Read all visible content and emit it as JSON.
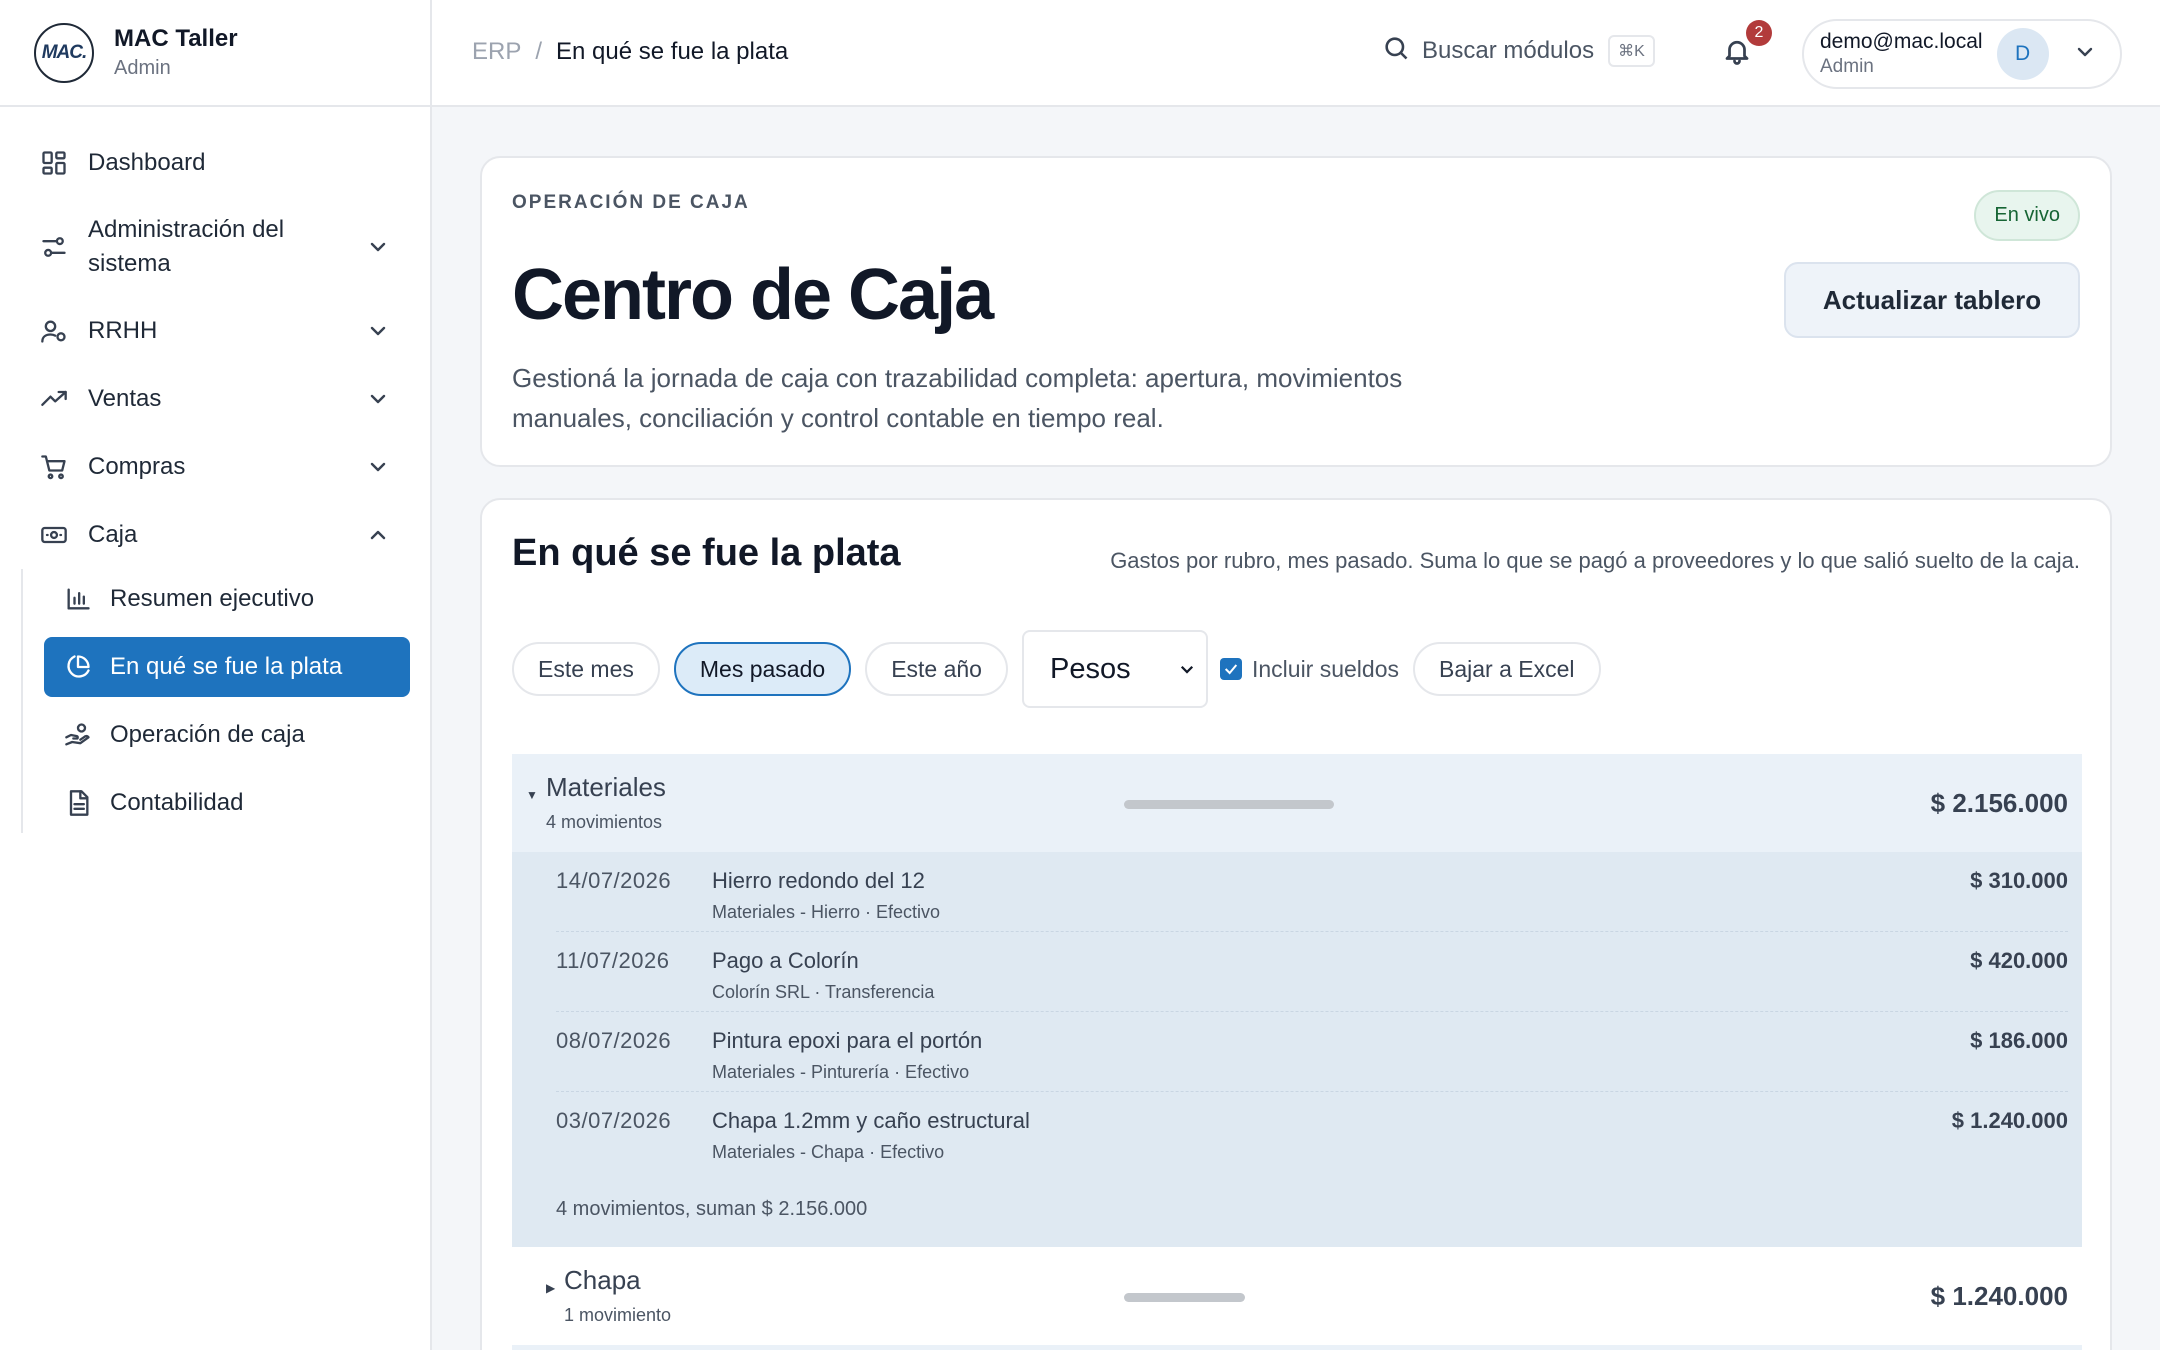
{
  "brand": {
    "logo": "MAC.",
    "name": "MAC Taller",
    "role": "Admin"
  },
  "sidebar": {
    "items": [
      {
        "label": "Dashboard",
        "icon": "dashboard-icon"
      },
      {
        "label": "Administración del sistema",
        "icon": "sliders-icon"
      },
      {
        "label": "RRHH",
        "icon": "user-cog-icon"
      },
      {
        "label": "Ventas",
        "icon": "trending-up-icon"
      },
      {
        "label": "Compras",
        "icon": "cart-icon"
      },
      {
        "label": "Caja",
        "icon": "cash-icon"
      }
    ],
    "caja_sub": [
      {
        "label": "Resumen ejecutivo",
        "icon": "bar-chart-icon"
      },
      {
        "label": "En qué se fue la plata",
        "icon": "pie-chart-icon",
        "active": true
      },
      {
        "label": "Operación de caja",
        "icon": "hand-coins-icon"
      },
      {
        "label": "Contabilidad",
        "icon": "document-icon"
      }
    ]
  },
  "topbar": {
    "breadcrumb_root": "ERP",
    "breadcrumb_sep": "/",
    "breadcrumb_current": "En qué se fue la plata",
    "search_label": "Buscar módulos",
    "search_shortcut": "⌘K",
    "notifications_count": "2",
    "user_email": "demo@mac.local",
    "user_role": "Admin",
    "user_initial": "D"
  },
  "hero": {
    "eyebrow": "OPERACIÓN DE CAJA",
    "status": "En vivo",
    "title": "Centro de Caja",
    "refresh_label": "Actualizar tablero",
    "description": "Gestioná la jornada de caja con trazabilidad completa: apertura, movimientos manuales, conciliación y control contable en tiempo real."
  },
  "spend": {
    "title": "En qué se fue la plata",
    "subtitle": "Gastos por rubro, mes pasado. Suma lo que se pagó a proveedores y lo que salió suelto de la caja.",
    "filters": [
      "Este mes",
      "Mes pasado",
      "Este año"
    ],
    "active_filter": "Mes pasado",
    "currency": "Pesos",
    "include_salaries_label": "Incluir sueldos",
    "include_salaries": true,
    "export_label": "Bajar a Excel",
    "groups": [
      {
        "name": "Materiales",
        "count_label": "4 movimientos",
        "total": "$ 2.156.000",
        "share": 1.0,
        "expanded": true,
        "rows": [
          {
            "date": "14/07/2026",
            "desc": "Hierro redondo del 12",
            "meta": "Materiales - Hierro · Efectivo",
            "amount": "$ 310.000"
          },
          {
            "date": "11/07/2026",
            "desc": "Pago a Colorín",
            "meta": "Colorín SRL · Transferencia",
            "amount": "$ 420.000"
          },
          {
            "date": "08/07/2026",
            "desc": "Pintura epoxi para el portón",
            "meta": "Materiales - Pinturería · Efectivo",
            "amount": "$ 186.000"
          },
          {
            "date": "03/07/2026",
            "desc": "Chapa 1.2mm y caño estructural",
            "meta": "Materiales - Chapa · Efectivo",
            "amount": "$ 1.240.000"
          }
        ],
        "summary": "4 movimientos, suman $ 2.156.000"
      },
      {
        "name": "Chapa",
        "count_label": "1 movimiento",
        "total": "$ 1.240.000",
        "share": 0.575,
        "expanded": false
      }
    ]
  }
}
